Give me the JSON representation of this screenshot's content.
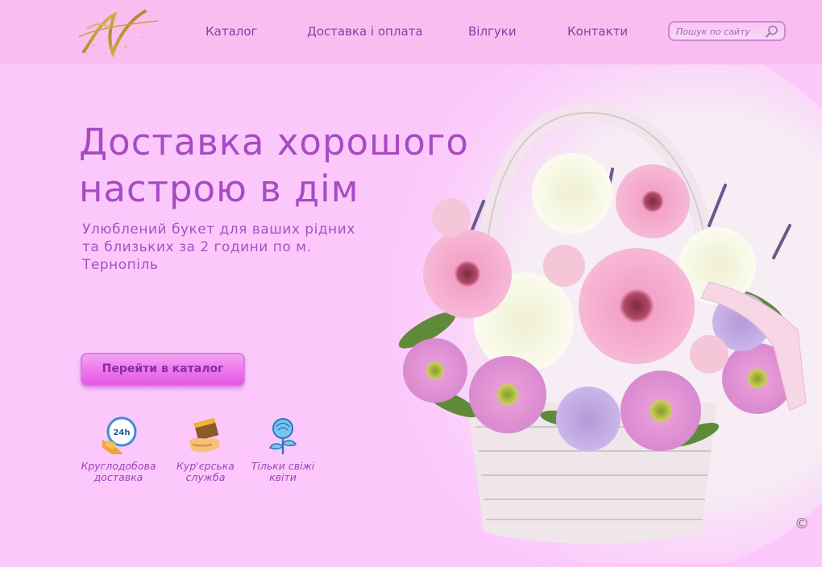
{
  "header": {
    "logo_letter": "N",
    "nav": [
      {
        "label": "Каталог"
      },
      {
        "label": "Доставка і оплата"
      },
      {
        "label": "Вілгуки"
      },
      {
        "label": "Контакти"
      }
    ],
    "search": {
      "placeholder": "Пошук по сайту",
      "value": ""
    }
  },
  "hero": {
    "title": "Доставка хорошого настрою в дім",
    "subtitle": "Улюблений букет для ваших рідних та близьких за 2 години по м. Тернопіль",
    "cta_label": "Перейти в каталог"
  },
  "features": [
    {
      "label": "Круглодобова доставка",
      "icon": "24h-delivery-icon"
    },
    {
      "label": "Кур'єрська служба",
      "icon": "courier-box-icon"
    },
    {
      "label": "Тільки свіжі квіти",
      "icon": "rose-icon"
    }
  ],
  "footer": {
    "copyright_symbol": "©"
  },
  "colors": {
    "background": "#fcc8fc",
    "header": "#fbbdf0",
    "accent": "#a64bc2",
    "button": "#ec74ec"
  }
}
